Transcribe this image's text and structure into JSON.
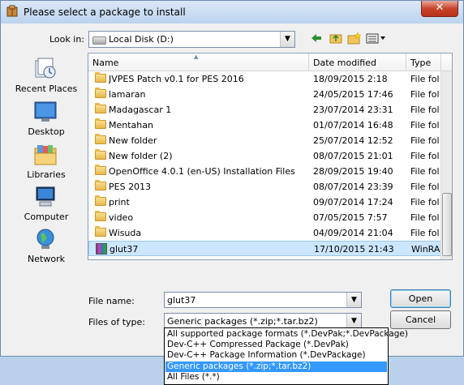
{
  "window": {
    "title": "Please select a package to install",
    "close_glyph": "✕"
  },
  "lookin": {
    "label": "Look in:",
    "value": "Local Disk (D:)"
  },
  "toolbar": {
    "icons": [
      "back-icon",
      "up-folder-icon",
      "new-folder-icon",
      "view-menu-icon"
    ]
  },
  "places": [
    {
      "label": "Recent Places"
    },
    {
      "label": "Desktop"
    },
    {
      "label": "Libraries"
    },
    {
      "label": "Computer"
    },
    {
      "label": "Network"
    }
  ],
  "columns": {
    "name": "Name",
    "date": "Date modified",
    "type": "Type"
  },
  "files": [
    {
      "name": "JVPES Patch v0.1 for PES 2016",
      "date": "18/09/2015 2:18",
      "type": "File fol",
      "kind": "folder"
    },
    {
      "name": "lamaran",
      "date": "24/05/2015 17:46",
      "type": "File fol",
      "kind": "folder"
    },
    {
      "name": "Madagascar 1",
      "date": "23/07/2014 23:31",
      "type": "File fol",
      "kind": "folder"
    },
    {
      "name": "Mentahan",
      "date": "01/07/2014 16:48",
      "type": "File fol",
      "kind": "folder"
    },
    {
      "name": "New folder",
      "date": "25/07/2014 12:52",
      "type": "File fol",
      "kind": "folder"
    },
    {
      "name": "New folder (2)",
      "date": "08/07/2015 21:01",
      "type": "File fol",
      "kind": "folder"
    },
    {
      "name": "OpenOffice 4.0.1 (en-US) Installation Files",
      "date": "28/09/2015 19:40",
      "type": "File fol",
      "kind": "folder"
    },
    {
      "name": "PES 2013",
      "date": "08/07/2014 23:39",
      "type": "File fol",
      "kind": "folder"
    },
    {
      "name": "print",
      "date": "09/07/2014 17:24",
      "type": "File fol",
      "kind": "folder"
    },
    {
      "name": "video",
      "date": "07/05/2015 7:57",
      "type": "File fol",
      "kind": "folder"
    },
    {
      "name": "Wisuda",
      "date": "04/09/2014 21:04",
      "type": "File fol",
      "kind": "folder"
    },
    {
      "name": "glut37",
      "date": "17/10/2015 21:43",
      "type": "WinRA",
      "kind": "archive",
      "selected": true
    }
  ],
  "filename": {
    "label": "File name:",
    "value": "glut37"
  },
  "filetype": {
    "label": "Files of type:",
    "value": "Generic packages (*.zip;*.tar.bz2)"
  },
  "buttons": {
    "open": "Open",
    "cancel": "Cancel"
  },
  "filetype_options": [
    {
      "label": "All supported package formats (*.DevPak;*.DevPackage)"
    },
    {
      "label": "Dev-C++ Compressed Package (*.DevPak)"
    },
    {
      "label": "Dev-C++ Package Information (*.DevPackage)"
    },
    {
      "label": "Generic packages (*.zip;*.tar.bz2)",
      "highlighted": true
    },
    {
      "label": "All Files (*.*)"
    }
  ]
}
